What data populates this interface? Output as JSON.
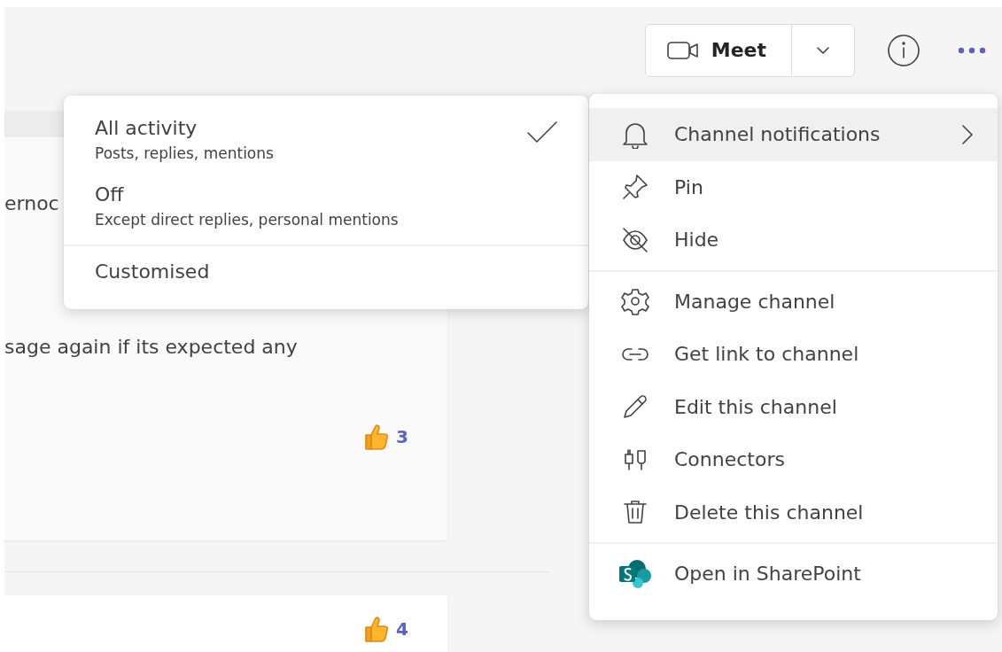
{
  "header": {
    "meet_button": {
      "label": "Meet"
    }
  },
  "messages": [
    {
      "lines": [
        "ernoc",
        "sage again if its expected any"
      ],
      "reaction": {
        "count": "3"
      }
    },
    {
      "reaction": {
        "count": "4"
      }
    }
  ],
  "notification_submenu": {
    "options": [
      {
        "title": "All activity",
        "description": "Posts, replies, mentions",
        "selected": true
      },
      {
        "title": "Off",
        "description": "Except direct replies, personal mentions",
        "selected": false
      }
    ],
    "custom": {
      "title": "Customised"
    }
  },
  "menu": {
    "sections": [
      [
        {
          "label": "Channel notifications",
          "highlighted": true,
          "has_submenu": true
        },
        {
          "label": "Pin",
          "highlighted": false,
          "has_submenu": false
        },
        {
          "label": "Hide",
          "highlighted": false,
          "has_submenu": false
        }
      ],
      [
        {
          "label": "Manage channel",
          "highlighted": false,
          "has_submenu": false
        },
        {
          "label": "Get link to channel",
          "highlighted": false,
          "has_submenu": false
        },
        {
          "label": "Edit this channel",
          "highlighted": false,
          "has_submenu": false
        },
        {
          "label": "Connectors",
          "highlighted": false,
          "has_submenu": false
        },
        {
          "label": "Delete this channel",
          "highlighted": false,
          "has_submenu": false
        }
      ],
      [
        {
          "label": "Open in SharePoint",
          "highlighted": false,
          "has_submenu": false
        }
      ]
    ]
  }
}
